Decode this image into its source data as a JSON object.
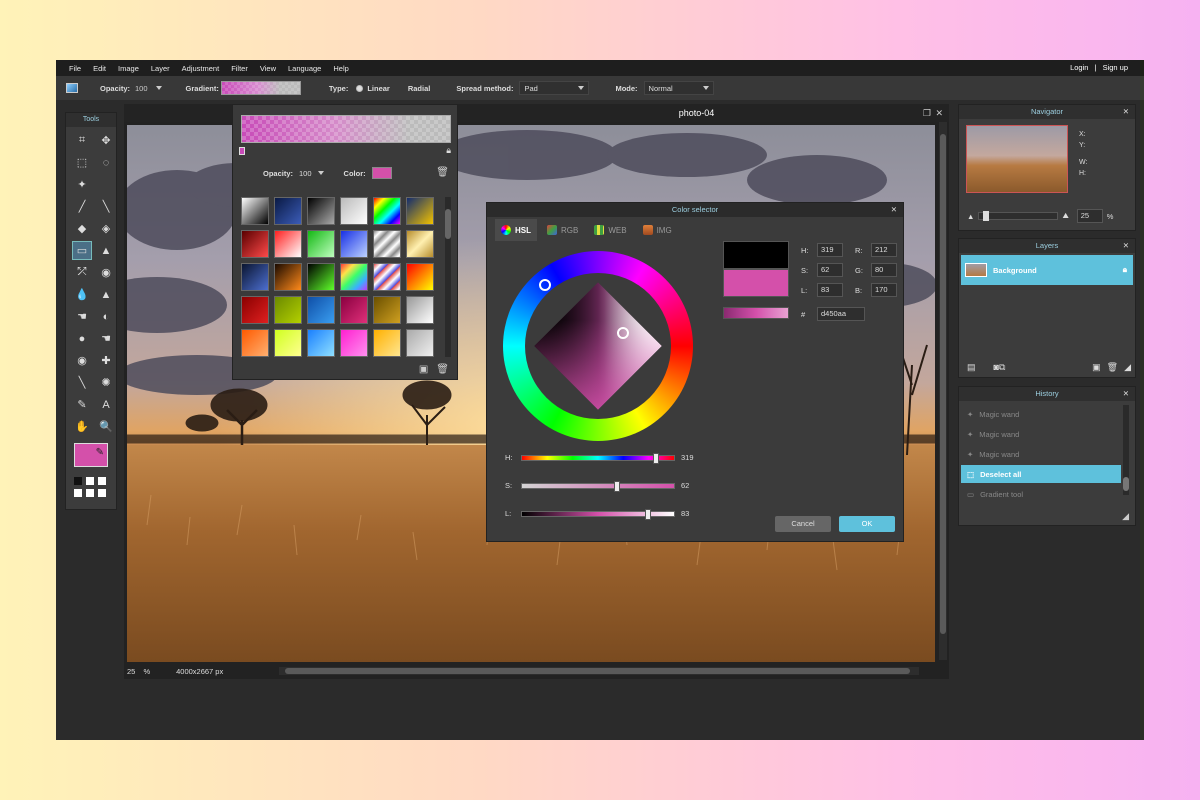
{
  "menubar": {
    "items": [
      "File",
      "Edit",
      "Image",
      "Layer",
      "Adjustment",
      "Filter",
      "View",
      "Language",
      "Help"
    ],
    "login": "Login",
    "separator": "|",
    "signup": "Sign up"
  },
  "options": {
    "opacity_label": "Opacity:",
    "opacity_value": "100",
    "gradient_label": "Gradient:",
    "type_label": "Type:",
    "type_linear": "Linear",
    "type_radial": "Radial",
    "spread_label": "Spread method:",
    "spread_value": "Pad",
    "mode_label": "Mode:",
    "mode_value": "Normal"
  },
  "tools": {
    "title": "Tools",
    "icons": [
      "crop-icon",
      "move-icon",
      "marquee-icon",
      "lasso-icon",
      "magic-wand-icon",
      "blank",
      "pencil-icon",
      "brush-icon",
      "eraser-icon",
      "bucket-icon",
      "gradient-icon",
      "stamp-icon",
      "replace-color-icon",
      "spot-heal-icon",
      "blur-icon",
      "sharpen-icon",
      "smudge-icon",
      "sponge-icon",
      "dodge-icon",
      "burn-icon",
      "red-eye-icon",
      "bloat-icon",
      "color-picker-icon",
      "pinch-icon",
      "drawing-icon",
      "type-icon",
      "hand-icon",
      "zoom-icon"
    ],
    "glyphs": [
      "⌗",
      "✥",
      "⬚",
      "◌",
      "✦",
      "",
      "╱",
      "╲",
      "◆",
      "◈",
      "▭",
      "▲",
      "⤱",
      "◉",
      "💧",
      "▲",
      "☚",
      "◐",
      "●",
      "☚",
      "◉",
      "✚",
      "╲",
      "✺",
      "✎",
      "A",
      "✋",
      "🔍"
    ],
    "active_index": 10,
    "fg_color": "#d450aa"
  },
  "canvas": {
    "title": "photo-04",
    "zoom": "25",
    "zoom_unit": "%",
    "dimensions": "4000x2667 px"
  },
  "gradient_popup": {
    "opacity_label": "Opacity:",
    "opacity_value": "100",
    "color_label": "Color:",
    "presets": [
      "linear-gradient(135deg,#fff,#000)",
      "linear-gradient(135deg,#0a1a44,#3b5cb8)",
      "linear-gradient(135deg,#000,#aaa)",
      "linear-gradient(135deg,#bbb,#fff)",
      "linear-gradient(135deg,#f00,#ff0,#0f0,#0ff,#00f,#f0f)",
      "linear-gradient(135deg,#132c6e,#f2c200)",
      "linear-gradient(135deg,#5a0000,#ff4a4a)",
      "linear-gradient(135deg,#ff2020,#fff)",
      "linear-gradient(135deg,#14b814,#bfffbf)",
      "linear-gradient(135deg,#1830e6,#bcd2ff)",
      "repeating-linear-gradient(135deg,#888 0,#fff 5px,#888 10px)",
      "linear-gradient(135deg,#b78d2c,#fff0b0,#b78d2c)",
      "linear-gradient(135deg,#0a1530,#4d6fd0)",
      "linear-gradient(135deg,#1a0a00,#ff8a1a)",
      "linear-gradient(135deg,#000,#5fff2a)",
      "linear-gradient(135deg,#ff3a3a,#ffe14a,#3aff6a,#3ab0ff,#c03aff)",
      "repeating-linear-gradient(135deg,#d44 0,#fff 5px,#44d 10px)",
      "linear-gradient(135deg,#f00,#ff0)",
      "linear-gradient(135deg,#8a0000,#e02020)",
      "linear-gradient(135deg,#6b8a00,#b4d000)",
      "linear-gradient(135deg,#0f4fa8,#3a9ef0)",
      "linear-gradient(135deg,#8a0040,#e0307a)",
      "linear-gradient(135deg,#6a5000,#d0a020)",
      "linear-gradient(135deg,#999,#fff)",
      "linear-gradient(135deg,#ff5a00,#ffb070)",
      "linear-gradient(135deg,#d0ff20,#ffff90)",
      "linear-gradient(135deg,#1a80ff,#8fe0ff)",
      "linear-gradient(135deg,#ff20d0,#ff90ef)",
      "linear-gradient(135deg,#ffb000,#ffe690)",
      "linear-gradient(135deg,#aaa,#f0f0f0)"
    ]
  },
  "color_selector": {
    "title": "Color selector",
    "tabs": [
      {
        "label": "HSL",
        "color": "#d450aa"
      },
      {
        "label": "RGB",
        "color": "#e04040"
      },
      {
        "label": "WEB",
        "color": "#40a040"
      },
      {
        "label": "IMG",
        "color": "#e0803a"
      }
    ],
    "h_label": "H:",
    "s_label": "S:",
    "l_label": "L:",
    "h_value": "319",
    "s_value": "62",
    "l_value": "83",
    "r_label": "R:",
    "g_label": "G:",
    "b_label": "B:",
    "r_value": "212",
    "g_value": "80",
    "b_value": "170",
    "hex_label": "#",
    "hex_value": "d450aa",
    "h_fraction": 0.886,
    "s_fraction": 0.62,
    "l_fraction": 0.83,
    "old_color": "#000000",
    "new_color": "#d450aa",
    "cancel_label": "Cancel",
    "ok_label": "OK"
  },
  "navigator": {
    "title": "Navigator",
    "x_label": "X:",
    "y_label": "Y:",
    "w_label": "W:",
    "h_label": "H:",
    "zoom_value": "25",
    "zoom_unit": "%"
  },
  "layers": {
    "title": "Layers",
    "items": [
      {
        "name": "Background"
      }
    ]
  },
  "history": {
    "title": "History",
    "items": [
      "Magic wand",
      "Magic wand",
      "Magic wand",
      "Deselect all",
      "Gradient tool"
    ],
    "active_index": 3
  }
}
